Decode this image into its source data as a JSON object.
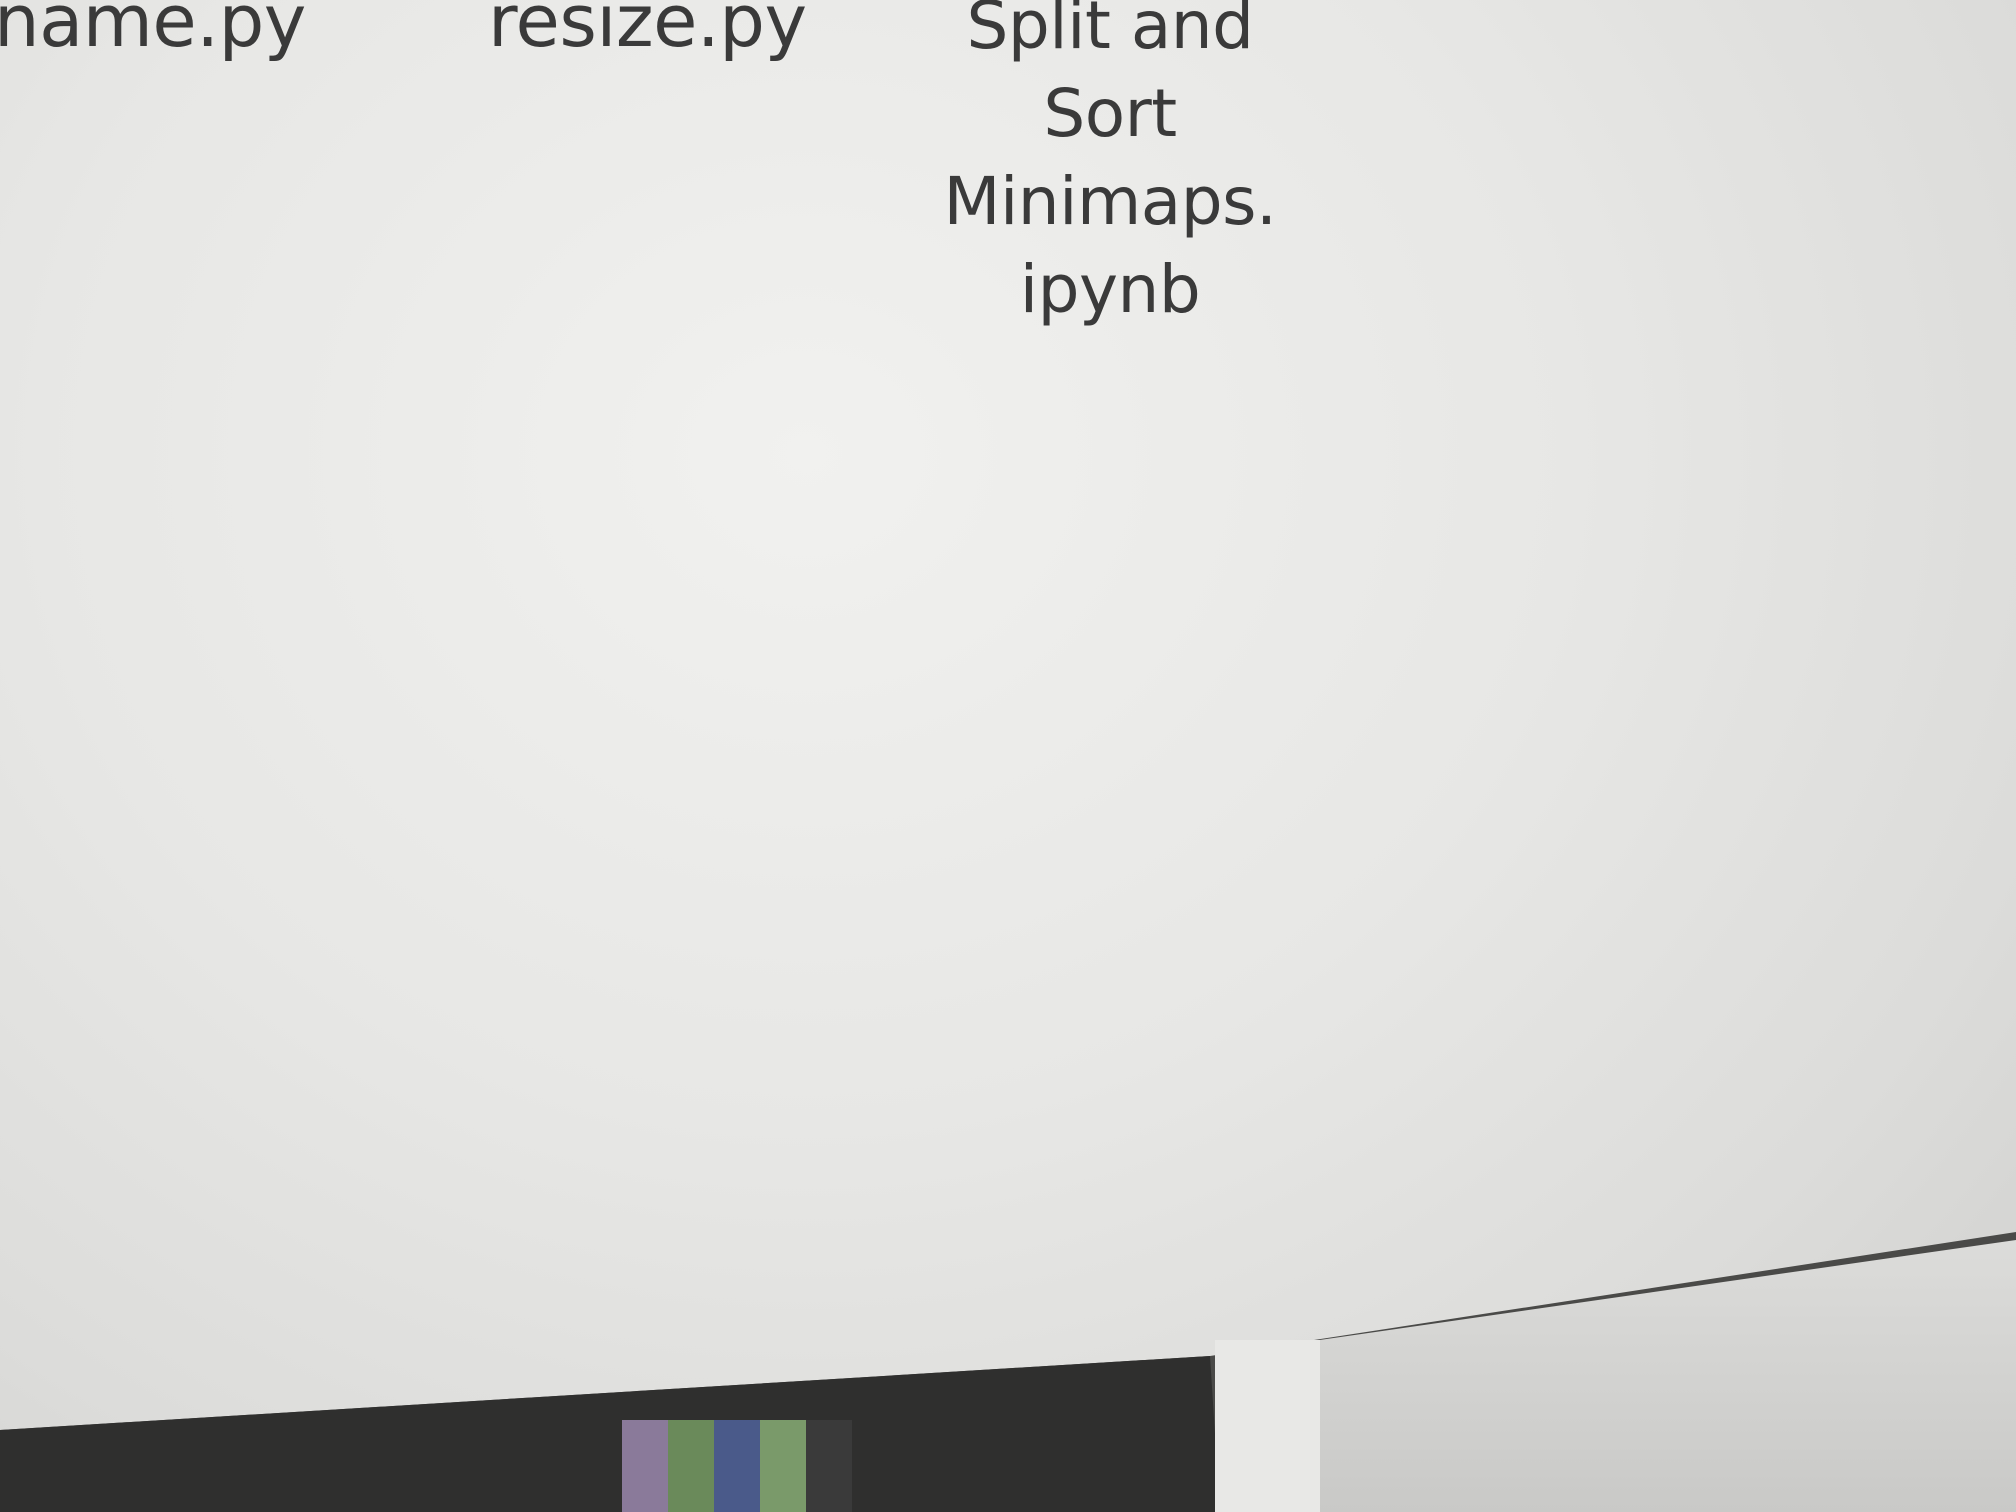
{
  "files": [
    {
      "name": "name.py"
    },
    {
      "name": "resize.py"
    },
    {
      "name_lines": [
        "Split and",
        "Sort",
        "Minimaps.",
        "ipynb"
      ]
    }
  ]
}
